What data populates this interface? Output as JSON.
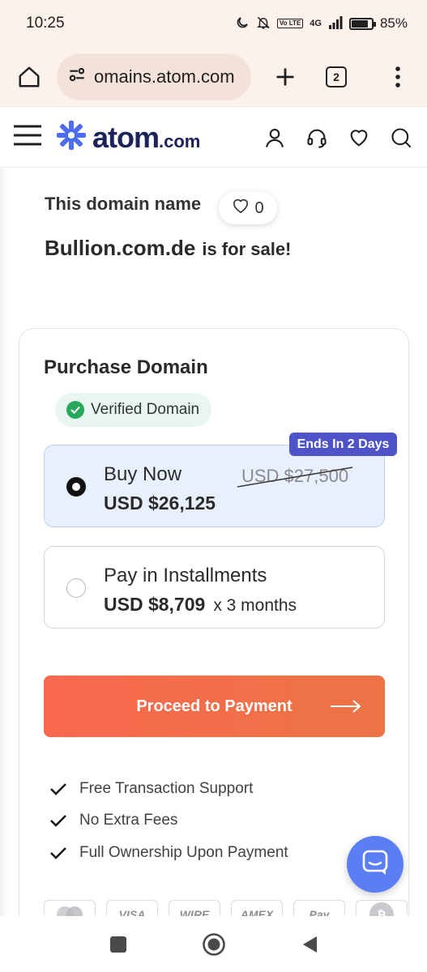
{
  "status_bar": {
    "time": "10:25",
    "network": "4G",
    "volte": "Vo LTE",
    "battery_percent": "85%",
    "battery_level": 0.85,
    "icons": [
      "moon-icon",
      "bell-off-icon",
      "volte-icon",
      "signal-icon",
      "battery-icon"
    ]
  },
  "browser": {
    "url": "domains.atom.com",
    "url_display": "omains.atom.com",
    "tab_count": "2",
    "icons": [
      "home-icon",
      "site-settings-icon",
      "plus-icon",
      "tabs-icon",
      "more-icon"
    ]
  },
  "site_header": {
    "logo_text": "atom",
    "logo_tld": ".com",
    "icons": [
      "hamburger-icon",
      "user-icon",
      "headset-icon",
      "heart-icon",
      "search-icon"
    ]
  },
  "hero": {
    "label": "This domain name",
    "likes": "0",
    "domain": "Bullion.com.de",
    "for_sale": "is for sale!"
  },
  "purchase": {
    "title": "Purchase Domain",
    "verified_label": "Verified Domain",
    "buy_now": {
      "title": "Buy Now",
      "price": "USD $26,125",
      "old_price": "USD $27,500",
      "badge": "Ends In 2 Days",
      "selected": true
    },
    "installments": {
      "title": "Pay in Installments",
      "price": "USD $8,709",
      "suffix": "x 3 months",
      "selected": false
    },
    "proceed_label": "Proceed to Payment",
    "benefits": [
      "Free Transaction Support",
      "No Extra Fees",
      "Full Ownership Upon Payment"
    ],
    "payment_methods": [
      "mastercard-icon",
      "visa-icon",
      "wire-icon",
      "amex-icon",
      "apple-pay-icon",
      "bitcoin-icon"
    ],
    "payment_labels": [
      "",
      "VISA",
      "WIRE",
      "AMEX",
      "Pay",
      "₿"
    ]
  },
  "colors": {
    "accent_blue": "#4e54c8",
    "button_orange": "#f56a4b",
    "verified_green": "#27a85b",
    "selected_bg": "#e9f0fd",
    "chat_blue": "#5b7ff2"
  }
}
